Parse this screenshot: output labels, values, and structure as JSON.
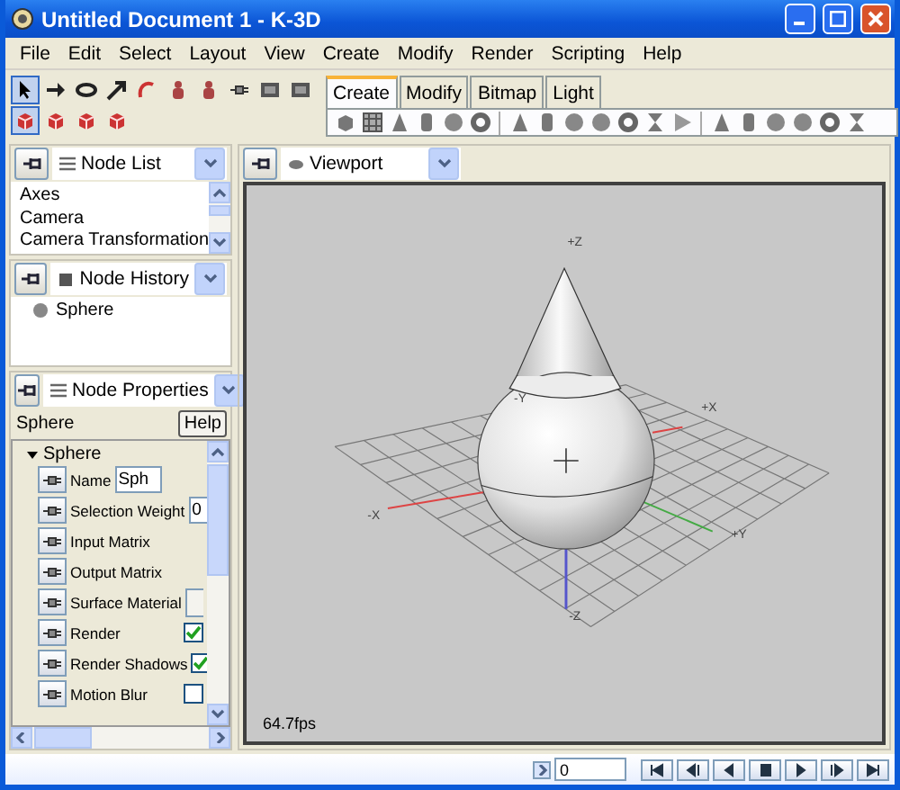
{
  "window": {
    "title": "Untitled Document 1 - K-3D"
  },
  "menu": [
    "File",
    "Edit",
    "Select",
    "Layout",
    "View",
    "Create",
    "Modify",
    "Render",
    "Scripting",
    "Help"
  ],
  "tools": [
    {
      "selected": true
    },
    {
      "selected": false
    },
    {
      "selected": false
    },
    {
      "selected": false
    },
    {
      "selected": false
    },
    {
      "selected": false
    },
    {
      "selected": false
    },
    {
      "selected": false
    },
    {
      "selected": false
    },
    {
      "selected": false
    }
  ],
  "modes": [
    {
      "selected": true
    },
    {
      "selected": false
    },
    {
      "selected": false
    },
    {
      "selected": false
    }
  ],
  "palette_tabs": [
    {
      "label": "Create",
      "selected": true
    },
    {
      "label": "Modify",
      "selected": false
    },
    {
      "label": "Bitmap",
      "selected": false
    },
    {
      "label": "Light",
      "selected": false
    }
  ],
  "node_list": {
    "title": "Node List",
    "items": [
      {
        "label": "Axes"
      },
      {
        "label": "Camera"
      },
      {
        "label": "Camera Transformation"
      }
    ]
  },
  "node_history": {
    "title": "Node History",
    "items": [
      {
        "label": "Sphere"
      }
    ]
  },
  "node_properties": {
    "title": "Node Properties",
    "node": "Sphere",
    "help": "Help",
    "group": {
      "label": "Sphere",
      "expanded": true
    },
    "properties": [
      {
        "label": "Name",
        "kind": "text",
        "value": "Sph"
      },
      {
        "label": "Selection Weight",
        "kind": "text",
        "value": "0"
      },
      {
        "label": "Input Matrix",
        "kind": "none"
      },
      {
        "label": "Output Matrix",
        "kind": "none"
      },
      {
        "label": "Surface Material",
        "kind": "button"
      },
      {
        "label": "Render",
        "kind": "checkbox",
        "checked": true
      },
      {
        "label": "Render Shadows",
        "kind": "checkbox",
        "checked": true
      },
      {
        "label": "Motion Blur",
        "kind": "checkbox",
        "checked": false
      }
    ]
  },
  "viewport": {
    "title": "Viewport",
    "axis_labels": [
      "+Z",
      "-Y",
      "+X",
      "-X",
      "+Y",
      "-Z"
    ],
    "fps": "64.7fps"
  },
  "timeline": {
    "frame": "0"
  }
}
